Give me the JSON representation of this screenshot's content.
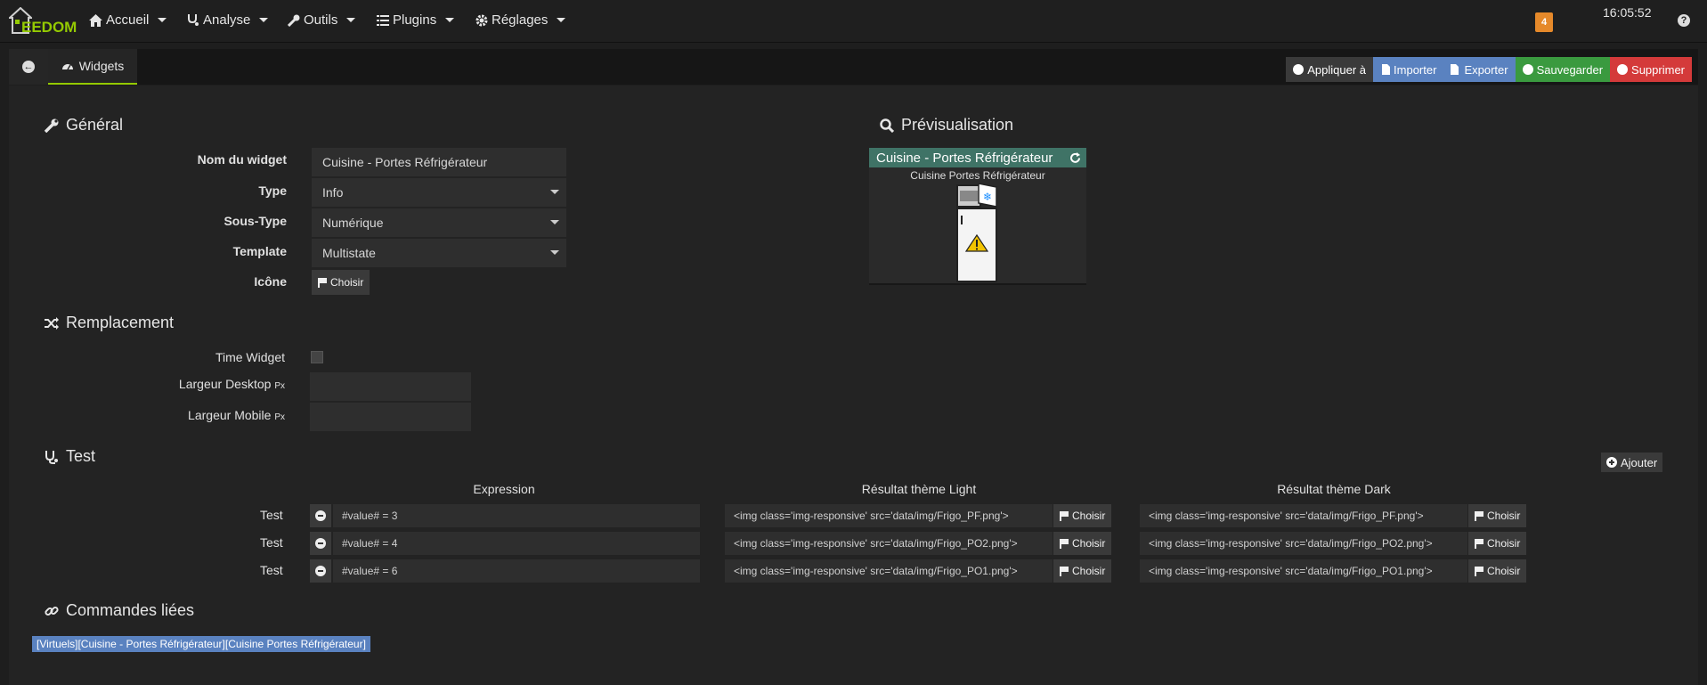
{
  "nav": {
    "logo_text": "EEDOM",
    "items": [
      {
        "label": "Accueil",
        "icon": "home-icon"
      },
      {
        "label": "Analyse",
        "icon": "stethoscope-icon"
      },
      {
        "label": "Outils",
        "icon": "wrench-icon"
      },
      {
        "label": "Plugins",
        "icon": "list-icon"
      },
      {
        "label": "Réglages",
        "icon": "cog-icon"
      }
    ],
    "badge": "4",
    "clock": "16:05:52",
    "help": "?"
  },
  "tabs": {
    "widgets_label": "Widgets"
  },
  "actions": {
    "apply": "Appliquer à",
    "import": "Importer",
    "export": "Exporter",
    "save": "Sauvegarder",
    "delete": "Supprimer"
  },
  "general": {
    "title": "Général",
    "name_label": "Nom du widget",
    "name_value": "Cuisine - Portes Réfrigérateur",
    "type_label": "Type",
    "type_value": "Info",
    "subtype_label": "Sous-Type",
    "subtype_value": "Numérique",
    "template_label": "Template",
    "template_value": "Multistate",
    "icon_label": "Icône",
    "choose": "Choisir"
  },
  "preview": {
    "title": "Prévisualisation",
    "widget_title": "Cuisine - Portes Réfrigérateur",
    "widget_subtitle": "Cuisine Portes Réfrigérateur"
  },
  "replacement": {
    "title": "Remplacement",
    "time_widget_label": "Time Widget",
    "desktop_label": "Largeur Desktop",
    "mobile_label": "Largeur Mobile",
    "unit": "Px"
  },
  "test": {
    "title": "Test",
    "add_label": "Ajouter",
    "col_expression": "Expression",
    "col_light": "Résultat thème Light",
    "col_dark": "Résultat thème Dark",
    "row_label": "Test",
    "choose": "Choisir",
    "rows": [
      {
        "expression": "#value# = 3",
        "light": "<img class='img-responsive' src='data/img/Frigo_PF.png'>",
        "dark": "<img class='img-responsive' src='data/img/Frigo_PF.png'>"
      },
      {
        "expression": "#value# = 4",
        "light": "<img class='img-responsive' src='data/img/Frigo_PO2.png'>",
        "dark": "<img class='img-responsive' src='data/img/Frigo_PO2.png'>"
      },
      {
        "expression": "#value# = 6",
        "light": "<img class='img-responsive' src='data/img/Frigo_PO1.png'>",
        "dark": "<img class='img-responsive' src='data/img/Frigo_PO1.png'>"
      }
    ]
  },
  "linked": {
    "title": "Commandes liées",
    "command": "[Virtuels][Cuisine - Portes Réfrigérateur][Cuisine Portes Réfrigérateur]"
  },
  "colors": {
    "accent": "#94ca02",
    "import": "#5a82c0",
    "save": "#3a9a3f",
    "delete": "#d43a3a",
    "preview_header": "#3f7366",
    "badge": "#e5892a"
  }
}
